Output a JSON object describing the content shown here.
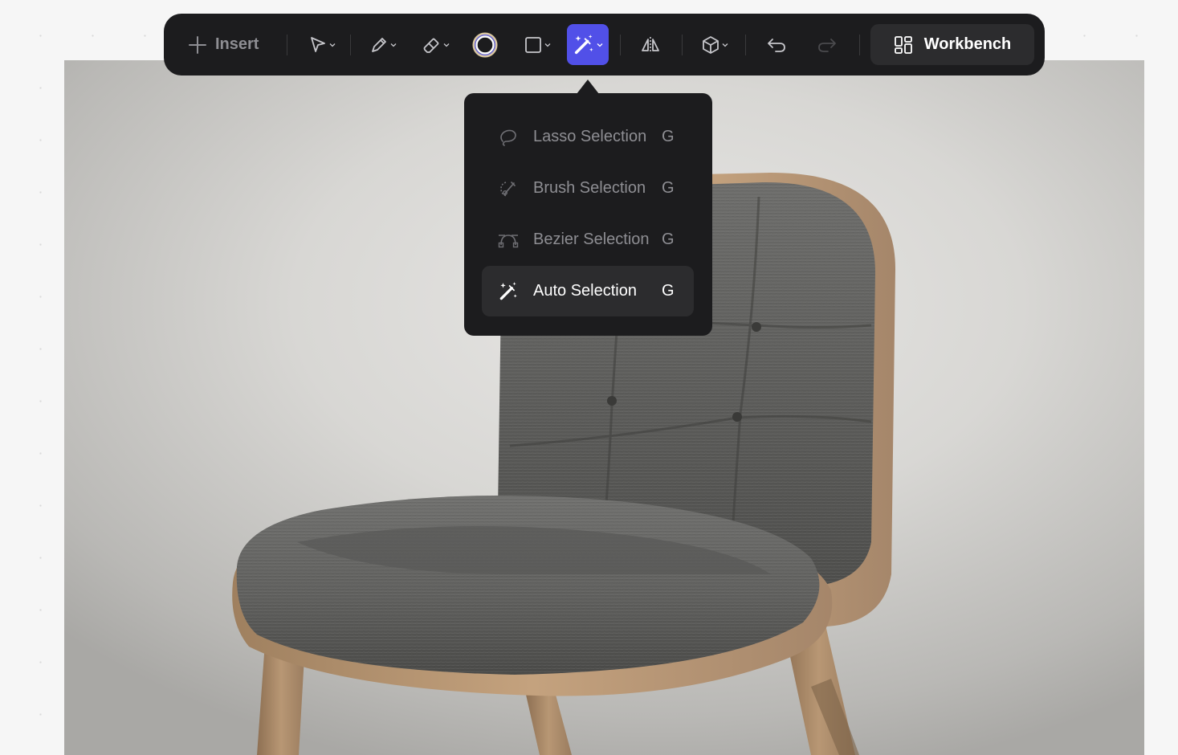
{
  "toolbar": {
    "insert_label": "Insert",
    "workbench_label": "Workbench",
    "accent_color": "#5150e8",
    "tools": [
      {
        "name": "select-tool",
        "icon": "cursor-arrow-icon",
        "has_menu": true
      },
      {
        "name": "pen-tool",
        "icon": "pen-icon",
        "has_menu": true
      },
      {
        "name": "eraser-tool",
        "icon": "eraser-icon",
        "has_menu": true
      },
      {
        "name": "color-tool",
        "icon": "color-ring-icon",
        "has_menu": false
      },
      {
        "name": "shape-tool",
        "icon": "square-icon",
        "has_menu": true
      },
      {
        "name": "selection-tool",
        "icon": "magic-wand-icon",
        "has_menu": true,
        "active": true
      },
      {
        "name": "mirror-tool",
        "icon": "flip-horizontal-icon",
        "has_menu": false
      },
      {
        "name": "3d-tool",
        "icon": "cube-icon",
        "has_menu": true
      },
      {
        "name": "undo-tool",
        "icon": "undo-icon",
        "has_menu": false
      },
      {
        "name": "redo-tool",
        "icon": "redo-icon",
        "has_menu": false,
        "disabled": true
      }
    ]
  },
  "selection_menu": {
    "items": [
      {
        "label": "Lasso Selection",
        "shortcut": "G",
        "icon": "lasso-icon"
      },
      {
        "label": "Brush Selection",
        "shortcut": "G",
        "icon": "brush-selection-icon"
      },
      {
        "label": "Bezier Selection",
        "shortcut": "G",
        "icon": "bezier-icon"
      },
      {
        "label": "Auto Selection",
        "shortcut": "G",
        "icon": "magic-wand-icon",
        "selected": true
      }
    ]
  }
}
